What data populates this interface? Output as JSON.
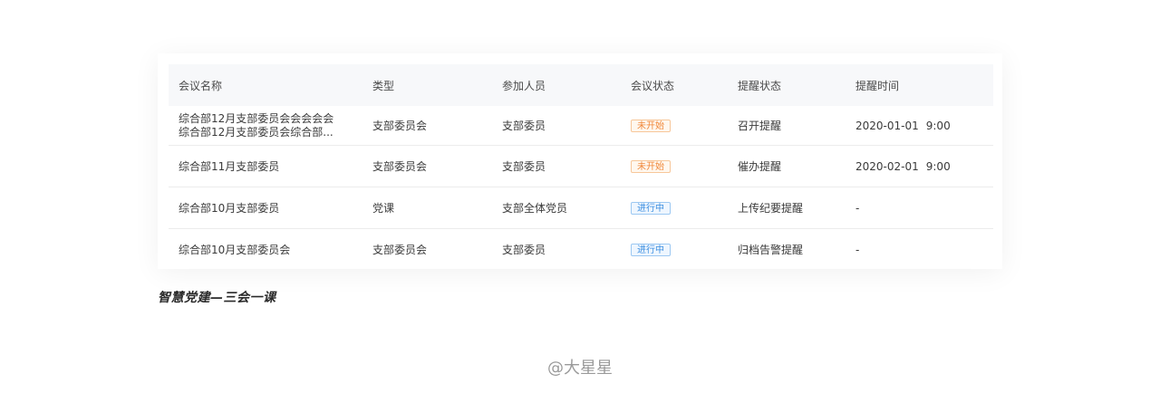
{
  "table": {
    "headers": [
      "会议名称",
      "类型",
      "参加人员",
      "会议状态",
      "提醒状态",
      "提醒时间"
    ],
    "rows": [
      {
        "name_line1": "综合部12月支部委员会会会会会",
        "name_line2": "综合部12月支部委员会综合部...",
        "type": "支部委员会",
        "people": "支部委员",
        "status": "未开始",
        "remind": "召开提醒",
        "date": "2020-01-01",
        "time": "9:00"
      },
      {
        "name": "综合部11月支部委员",
        "type": "支部委员会",
        "people": "支部委员",
        "status": "未开始",
        "remind": "催办提醒",
        "date": "2020-02-01",
        "time": "9:00"
      },
      {
        "name": "综合部10月支部委员",
        "type": "党课",
        "people": "支部全体党员",
        "status": "进行中",
        "remind": "上传纪要提醒",
        "date": "-"
      },
      {
        "name": "综合部10月支部委员会",
        "type": "支部委员会",
        "people": "支部委员",
        "status": "进行中",
        "remind": "归档告警提醒",
        "date": "-"
      }
    ]
  },
  "caption": "智慧党建—三会一课",
  "watermark": "@大星星",
  "colors": {
    "pending": "#f0883a",
    "ongoing": "#3d8fe0",
    "header_bg": "#f7f8fa"
  }
}
